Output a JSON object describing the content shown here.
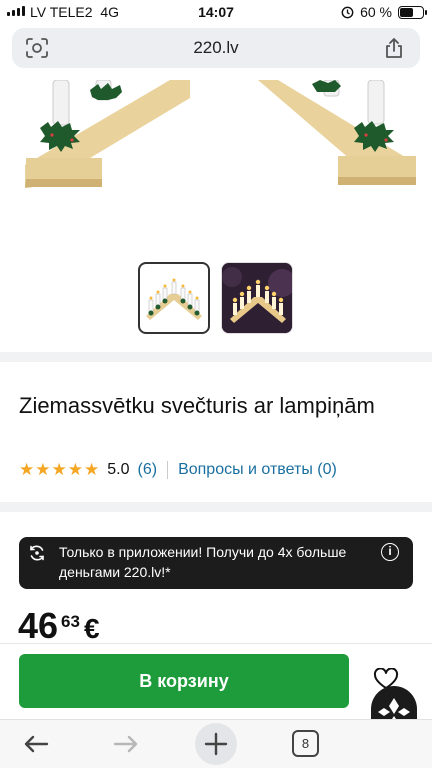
{
  "status_bar": {
    "carrier": "LV TELE2",
    "network": "4G",
    "time": "14:07",
    "battery": "60 %"
  },
  "browser": {
    "url": "220.lv",
    "tabs_count": "8"
  },
  "product": {
    "title": "Ziemassvētku svečturis ar lampiņām",
    "rating": {
      "stars": 5,
      "score": "5.0",
      "reviews": "(6)",
      "qa_link": "Вопросы и ответы (0)"
    },
    "promo_text": "Только в приложении! Получи до 4х больше деньгами 220.lv!*",
    "price": {
      "integer": "46",
      "decimal": "63",
      "currency": "€"
    },
    "cart_button": "В корзину",
    "thumbnails": [
      "wooden-candle-bridge-white",
      "wooden-candle-bridge-dark"
    ]
  },
  "colors": {
    "accent_green": "#1e9b3a",
    "link_blue": "#1a6fa0",
    "star": "#f5a623",
    "promo_bg": "#1c1c1c"
  },
  "icons": [
    "signal-icon",
    "alarm-icon",
    "battery-icon",
    "camera-scan-icon",
    "share-icon",
    "star-icon",
    "gift-refresh-icon",
    "info-icon",
    "heart-icon",
    "back-icon",
    "forward-icon",
    "plus-icon",
    "tabs-icon"
  ]
}
